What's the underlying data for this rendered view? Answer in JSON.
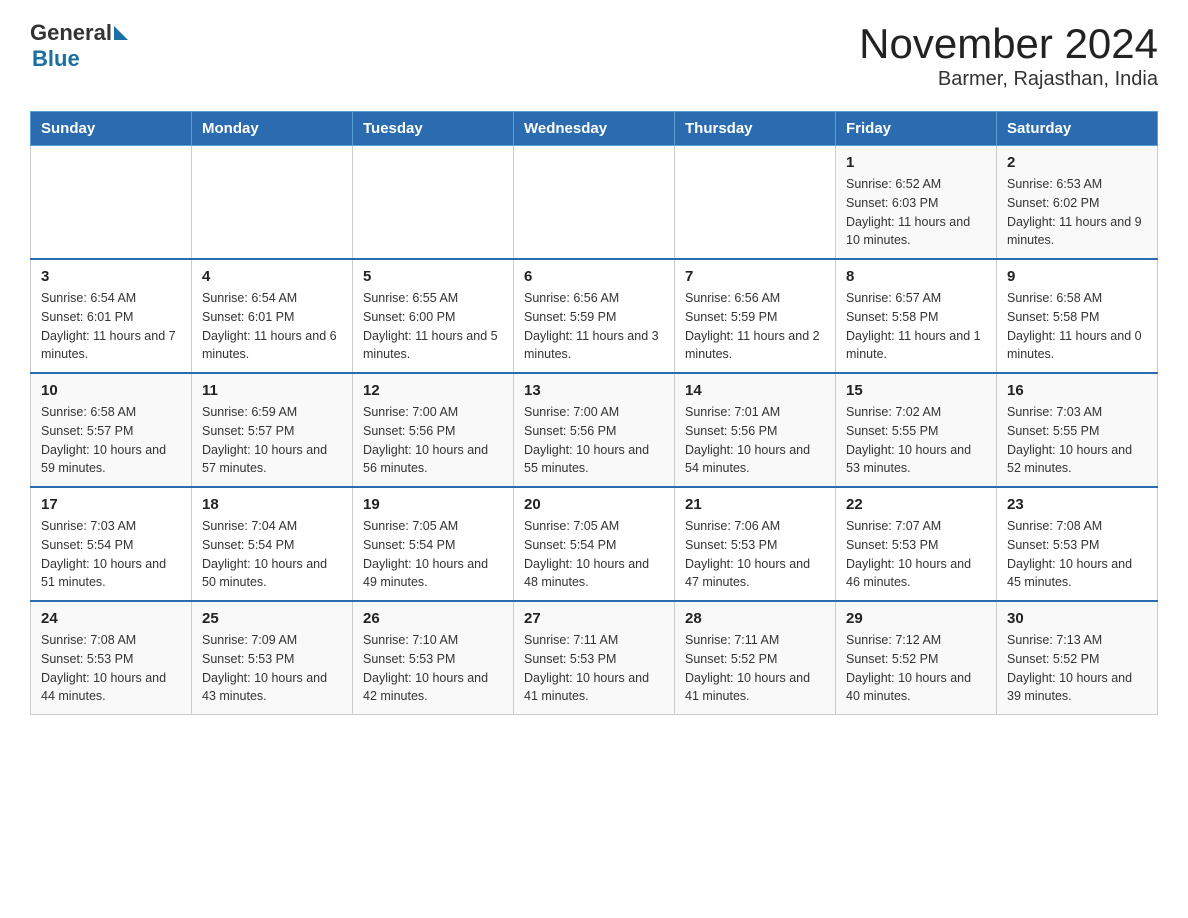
{
  "logo": {
    "text_general": "General",
    "text_blue": "Blue"
  },
  "title": "November 2024",
  "subtitle": "Barmer, Rajasthan, India",
  "weekdays": [
    "Sunday",
    "Monday",
    "Tuesday",
    "Wednesday",
    "Thursday",
    "Friday",
    "Saturday"
  ],
  "weeks": [
    [
      {
        "day": "",
        "sunrise": "",
        "sunset": "",
        "daylight": ""
      },
      {
        "day": "",
        "sunrise": "",
        "sunset": "",
        "daylight": ""
      },
      {
        "day": "",
        "sunrise": "",
        "sunset": "",
        "daylight": ""
      },
      {
        "day": "",
        "sunrise": "",
        "sunset": "",
        "daylight": ""
      },
      {
        "day": "",
        "sunrise": "",
        "sunset": "",
        "daylight": ""
      },
      {
        "day": "1",
        "sunrise": "Sunrise: 6:52 AM",
        "sunset": "Sunset: 6:03 PM",
        "daylight": "Daylight: 11 hours and 10 minutes."
      },
      {
        "day": "2",
        "sunrise": "Sunrise: 6:53 AM",
        "sunset": "Sunset: 6:02 PM",
        "daylight": "Daylight: 11 hours and 9 minutes."
      }
    ],
    [
      {
        "day": "3",
        "sunrise": "Sunrise: 6:54 AM",
        "sunset": "Sunset: 6:01 PM",
        "daylight": "Daylight: 11 hours and 7 minutes."
      },
      {
        "day": "4",
        "sunrise": "Sunrise: 6:54 AM",
        "sunset": "Sunset: 6:01 PM",
        "daylight": "Daylight: 11 hours and 6 minutes."
      },
      {
        "day": "5",
        "sunrise": "Sunrise: 6:55 AM",
        "sunset": "Sunset: 6:00 PM",
        "daylight": "Daylight: 11 hours and 5 minutes."
      },
      {
        "day": "6",
        "sunrise": "Sunrise: 6:56 AM",
        "sunset": "Sunset: 5:59 PM",
        "daylight": "Daylight: 11 hours and 3 minutes."
      },
      {
        "day": "7",
        "sunrise": "Sunrise: 6:56 AM",
        "sunset": "Sunset: 5:59 PM",
        "daylight": "Daylight: 11 hours and 2 minutes."
      },
      {
        "day": "8",
        "sunrise": "Sunrise: 6:57 AM",
        "sunset": "Sunset: 5:58 PM",
        "daylight": "Daylight: 11 hours and 1 minute."
      },
      {
        "day": "9",
        "sunrise": "Sunrise: 6:58 AM",
        "sunset": "Sunset: 5:58 PM",
        "daylight": "Daylight: 11 hours and 0 minutes."
      }
    ],
    [
      {
        "day": "10",
        "sunrise": "Sunrise: 6:58 AM",
        "sunset": "Sunset: 5:57 PM",
        "daylight": "Daylight: 10 hours and 59 minutes."
      },
      {
        "day": "11",
        "sunrise": "Sunrise: 6:59 AM",
        "sunset": "Sunset: 5:57 PM",
        "daylight": "Daylight: 10 hours and 57 minutes."
      },
      {
        "day": "12",
        "sunrise": "Sunrise: 7:00 AM",
        "sunset": "Sunset: 5:56 PM",
        "daylight": "Daylight: 10 hours and 56 minutes."
      },
      {
        "day": "13",
        "sunrise": "Sunrise: 7:00 AM",
        "sunset": "Sunset: 5:56 PM",
        "daylight": "Daylight: 10 hours and 55 minutes."
      },
      {
        "day": "14",
        "sunrise": "Sunrise: 7:01 AM",
        "sunset": "Sunset: 5:56 PM",
        "daylight": "Daylight: 10 hours and 54 minutes."
      },
      {
        "day": "15",
        "sunrise": "Sunrise: 7:02 AM",
        "sunset": "Sunset: 5:55 PM",
        "daylight": "Daylight: 10 hours and 53 minutes."
      },
      {
        "day": "16",
        "sunrise": "Sunrise: 7:03 AM",
        "sunset": "Sunset: 5:55 PM",
        "daylight": "Daylight: 10 hours and 52 minutes."
      }
    ],
    [
      {
        "day": "17",
        "sunrise": "Sunrise: 7:03 AM",
        "sunset": "Sunset: 5:54 PM",
        "daylight": "Daylight: 10 hours and 51 minutes."
      },
      {
        "day": "18",
        "sunrise": "Sunrise: 7:04 AM",
        "sunset": "Sunset: 5:54 PM",
        "daylight": "Daylight: 10 hours and 50 minutes."
      },
      {
        "day": "19",
        "sunrise": "Sunrise: 7:05 AM",
        "sunset": "Sunset: 5:54 PM",
        "daylight": "Daylight: 10 hours and 49 minutes."
      },
      {
        "day": "20",
        "sunrise": "Sunrise: 7:05 AM",
        "sunset": "Sunset: 5:54 PM",
        "daylight": "Daylight: 10 hours and 48 minutes."
      },
      {
        "day": "21",
        "sunrise": "Sunrise: 7:06 AM",
        "sunset": "Sunset: 5:53 PM",
        "daylight": "Daylight: 10 hours and 47 minutes."
      },
      {
        "day": "22",
        "sunrise": "Sunrise: 7:07 AM",
        "sunset": "Sunset: 5:53 PM",
        "daylight": "Daylight: 10 hours and 46 minutes."
      },
      {
        "day": "23",
        "sunrise": "Sunrise: 7:08 AM",
        "sunset": "Sunset: 5:53 PM",
        "daylight": "Daylight: 10 hours and 45 minutes."
      }
    ],
    [
      {
        "day": "24",
        "sunrise": "Sunrise: 7:08 AM",
        "sunset": "Sunset: 5:53 PM",
        "daylight": "Daylight: 10 hours and 44 minutes."
      },
      {
        "day": "25",
        "sunrise": "Sunrise: 7:09 AM",
        "sunset": "Sunset: 5:53 PM",
        "daylight": "Daylight: 10 hours and 43 minutes."
      },
      {
        "day": "26",
        "sunrise": "Sunrise: 7:10 AM",
        "sunset": "Sunset: 5:53 PM",
        "daylight": "Daylight: 10 hours and 42 minutes."
      },
      {
        "day": "27",
        "sunrise": "Sunrise: 7:11 AM",
        "sunset": "Sunset: 5:53 PM",
        "daylight": "Daylight: 10 hours and 41 minutes."
      },
      {
        "day": "28",
        "sunrise": "Sunrise: 7:11 AM",
        "sunset": "Sunset: 5:52 PM",
        "daylight": "Daylight: 10 hours and 41 minutes."
      },
      {
        "day": "29",
        "sunrise": "Sunrise: 7:12 AM",
        "sunset": "Sunset: 5:52 PM",
        "daylight": "Daylight: 10 hours and 40 minutes."
      },
      {
        "day": "30",
        "sunrise": "Sunrise: 7:13 AM",
        "sunset": "Sunset: 5:52 PM",
        "daylight": "Daylight: 10 hours and 39 minutes."
      }
    ]
  ]
}
